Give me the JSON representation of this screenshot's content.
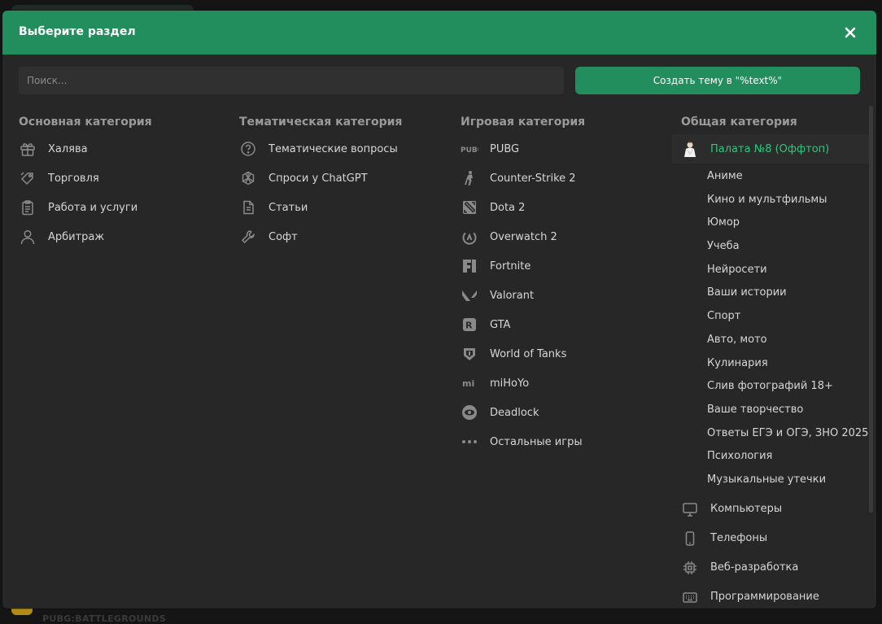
{
  "background": {
    "footer_text": "PUBG:BATTLEGROUNDS"
  },
  "modal": {
    "title": "Выберите раздел",
    "search_placeholder": "Поиск...",
    "create_button": "Создать тему в \"%text%\""
  },
  "columns": {
    "main": {
      "title": "Основная категория",
      "items": [
        {
          "label": "Халява",
          "icon": "gift-icon"
        },
        {
          "label": "Торговля",
          "icon": "tag-icon"
        },
        {
          "label": "Работа и услуги",
          "icon": "clipboard-icon"
        },
        {
          "label": "Арбитраж",
          "icon": "user-icon"
        }
      ]
    },
    "thematic": {
      "title": "Тематическая категория",
      "items": [
        {
          "label": "Тематические вопросы",
          "icon": "question-icon"
        },
        {
          "label": "Спроси у ChatGPT",
          "icon": "openai-icon"
        },
        {
          "label": "Статьи",
          "icon": "document-icon"
        },
        {
          "label": "Софт",
          "icon": "wrench-icon"
        }
      ]
    },
    "games": {
      "title": "Игровая категория",
      "items": [
        {
          "label": "PUBG",
          "icon": "pubg-icon"
        },
        {
          "label": "Counter-Strike 2",
          "icon": "counter-strike-icon"
        },
        {
          "label": "Dota 2",
          "icon": "dota-icon"
        },
        {
          "label": "Overwatch 2",
          "icon": "overwatch-icon"
        },
        {
          "label": "Fortnite",
          "icon": "fortnite-icon"
        },
        {
          "label": "Valorant",
          "icon": "valorant-icon"
        },
        {
          "label": "GTA",
          "icon": "rockstar-icon"
        },
        {
          "label": "World of Tanks",
          "icon": "wot-icon"
        },
        {
          "label": "miHoYo",
          "icon": "mihoyo-icon"
        },
        {
          "label": "Deadlock",
          "icon": "deadlock-icon"
        },
        {
          "label": "Остальные игры",
          "icon": "more-dots-icon"
        }
      ]
    },
    "general": {
      "title": "Общая категория",
      "active_item": {
        "label": "Палата №8 (Оффтоп)",
        "icon": "avatar-icon"
      },
      "subitems": [
        "Аниме",
        "Кино и мультфильмы",
        "Юмор",
        "Учеба",
        "Нейросети",
        "Ваши истории",
        "Спорт",
        "Авто, мото",
        "Кулинария",
        "Слив фотографий 18+",
        "Ваше творчество",
        "Ответы ЕГЭ и ОГЭ, ЗНО 2025",
        "Психология",
        "Музыкальные утечки"
      ],
      "items": [
        {
          "label": "Компьютеры",
          "icon": "monitor-icon"
        },
        {
          "label": "Телефоны",
          "icon": "phone-icon"
        },
        {
          "label": "Веб-разработка",
          "icon": "chip-icon"
        },
        {
          "label": "Программирование",
          "icon": "keyboard-icon"
        }
      ]
    }
  },
  "colors": {
    "accent": "#228e5d",
    "active_text": "#33c47f",
    "modal_bg": "#272727"
  }
}
